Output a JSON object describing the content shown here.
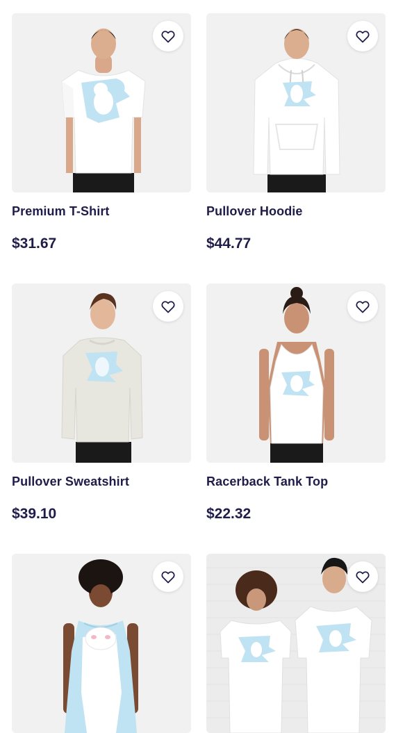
{
  "products": [
    {
      "title": "Premium T-Shirt",
      "price": "$31.67",
      "image_icon": "model-premium-tshirt-image"
    },
    {
      "title": "Pullover Hoodie",
      "price": "$44.77",
      "image_icon": "model-pullover-hoodie-image"
    },
    {
      "title": "Pullover Sweatshirt",
      "price": "$39.10",
      "image_icon": "model-pullover-sweatshirt-image"
    },
    {
      "title": "Racerback Tank Top",
      "price": "$22.32",
      "image_icon": "model-racerback-tank-image"
    },
    {
      "title": "",
      "price": "",
      "image_icon": "model-sleeveless-dress-image"
    },
    {
      "title": "",
      "price": "",
      "image_icon": "two-models-tshirt-image"
    }
  ],
  "favorite_icon": "heart-outline-icon",
  "colors": {
    "text": "#1f1c4a",
    "card_bg": "#f1f1f1",
    "print_blue": "#bfe3f3"
  }
}
